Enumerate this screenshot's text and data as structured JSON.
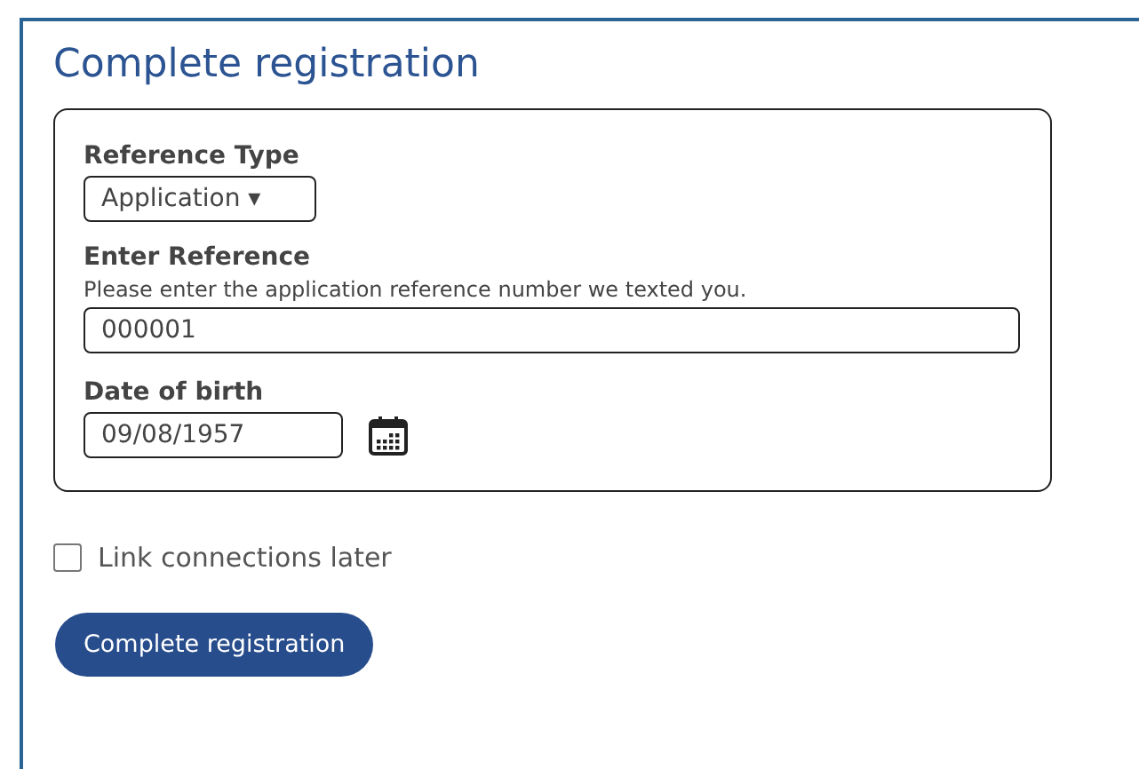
{
  "title": "Complete registration",
  "form": {
    "reference_type": {
      "label": "Reference Type",
      "value": "Application ▾"
    },
    "reference": {
      "label": "Enter Reference",
      "hint": "Please enter the application reference number we texted you.",
      "value": "000001"
    },
    "date_of_birth": {
      "label": "Date of birth",
      "value": "09/08/1957"
    }
  },
  "link_later": {
    "label": "Link connections later",
    "checked": false
  },
  "submit": {
    "label": "Complete registration"
  }
}
